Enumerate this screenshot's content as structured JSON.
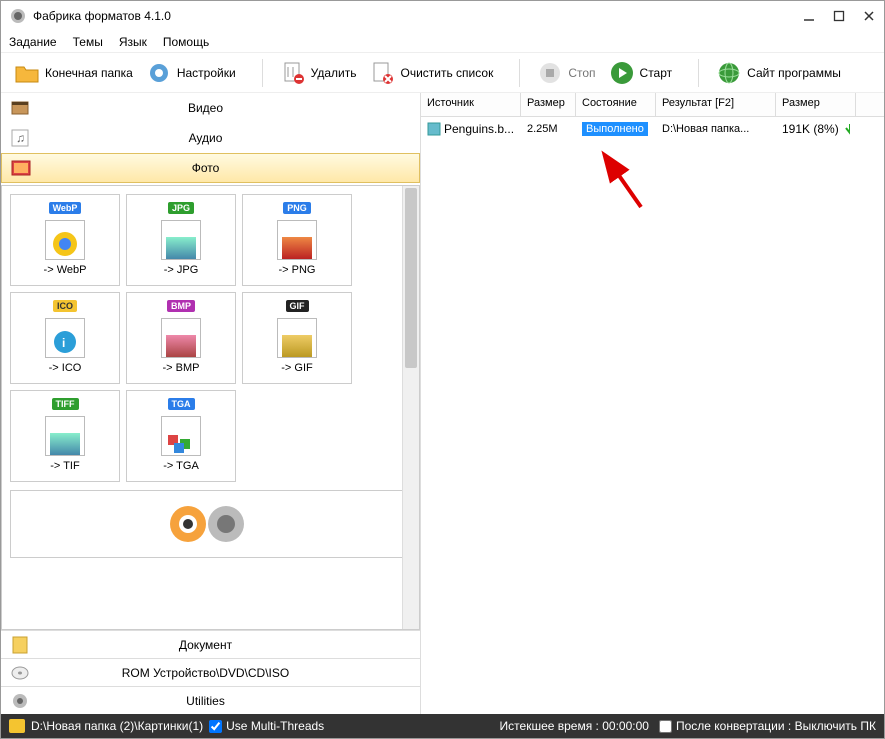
{
  "window": {
    "title": "Фабрика форматов 4.1.0"
  },
  "menu": {
    "task": "Задание",
    "skin": "Темы",
    "lang": "Язык",
    "help": "Помощь"
  },
  "toolbar": {
    "output": "Конечная папка",
    "option": "Настройки",
    "remove": "Удалить",
    "clear": "Очистить список",
    "stop": "Стоп",
    "start": "Старт",
    "site": "Сайт программы"
  },
  "categories": {
    "video": "Видео",
    "audio": "Аудио",
    "picture": "Фото",
    "document": "Документ",
    "rom": "ROM Устройство\\DVD\\CD\\ISO",
    "utilities": "Utilities"
  },
  "formats": {
    "webp": {
      "badge": "WebP",
      "label": "-> WebP",
      "badgeColor": "#2b7de9"
    },
    "jpg": {
      "badge": "JPG",
      "label": "-> JPG",
      "badgeColor": "#2e9e2e"
    },
    "png": {
      "badge": "PNG",
      "label": "-> PNG",
      "badgeColor": "#2b7de9"
    },
    "ico": {
      "badge": "ICO",
      "label": "-> ICO",
      "badgeColor": "#f4c430"
    },
    "bmp": {
      "badge": "BMP",
      "label": "-> BMP",
      "badgeColor": "#b030b0"
    },
    "gif": {
      "badge": "GIF",
      "label": "-> GIF",
      "badgeColor": "#222"
    },
    "tif": {
      "badge": "TIFF",
      "label": "-> TIF",
      "badgeColor": "#2e9e2e"
    },
    "tga": {
      "badge": "TGA",
      "label": "-> TGA",
      "badgeColor": "#2b7de9"
    }
  },
  "table": {
    "headers": {
      "source": "Источник",
      "size": "Размер",
      "state": "Состояние",
      "result": "Результат [F2]",
      "size2": "Размер"
    },
    "rows": [
      {
        "source": "Penguins.b...",
        "size": "2.25M",
        "state": "Выполнено",
        "result": "D:\\Новая папка...",
        "size2": "191K (8%)"
      }
    ]
  },
  "statusbar": {
    "path": "D:\\Новая папка (2)\\Картинки(1)",
    "multithread": "Use Multi-Threads",
    "elapsed_label": "Истекшее время : ",
    "elapsed_time": "00:00:00",
    "after_label": "После конвертации : Выключить ПК"
  }
}
